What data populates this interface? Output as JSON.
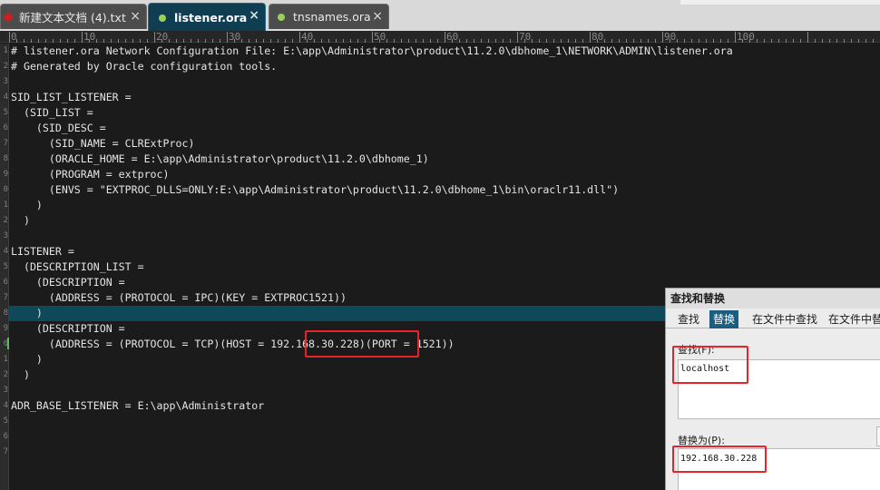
{
  "tabs": [
    {
      "label": "新建文本文档 (4).txt",
      "close": "×"
    },
    {
      "label": "listener.ora",
      "close": "×"
    },
    {
      "label": "tnsnames.ora",
      "close": "×"
    }
  ],
  "ruler": {
    "labels": [
      "0",
      "10",
      "20",
      "30",
      "40",
      "50",
      "60",
      "70",
      "80",
      "90",
      "100"
    ]
  },
  "gutter": {
    "numbers": [
      "1",
      "2",
      "3",
      "4",
      "5",
      "6",
      "7",
      "8",
      "9",
      "0",
      "1",
      "2",
      "3",
      "4",
      "5",
      "6",
      "7",
      "8",
      "9",
      "0",
      "1",
      "2",
      "3",
      "4",
      "5",
      "6",
      "7"
    ]
  },
  "code": {
    "lines": [
      "# listener.ora Network Configuration File: E:\\app\\Administrator\\product\\11.2.0\\dbhome_1\\NETWORK\\ADMIN\\listener.ora",
      "# Generated by Oracle configuration tools.",
      "",
      "SID_LIST_LISTENER =",
      "  (SID_LIST =",
      "    (SID_DESC =",
      "      (SID_NAME = CLRExtProc)",
      "      (ORACLE_HOME = E:\\app\\Administrator\\product\\11.2.0\\dbhome_1)",
      "      (PROGRAM = extproc)",
      "      (ENVS = \"EXTPROC_DLLS=ONLY:E:\\app\\Administrator\\product\\11.2.0\\dbhome_1\\bin\\oraclr11.dll\")",
      "    )",
      "  )",
      "",
      "LISTENER =",
      "  (DESCRIPTION_LIST =",
      "    (DESCRIPTION =",
      "      (ADDRESS = (PROTOCOL = IPC)(KEY = EXTPROC1521))",
      "    )",
      "    (DESCRIPTION =",
      "      (ADDRESS = (PROTOCOL = TCP)(HOST = 192.168.30.228)(PORT = 1521))",
      "    )",
      "  )",
      "",
      "ADR_BASE_LISTENER = E:\\app\\Administrator",
      "",
      "",
      ""
    ]
  },
  "find_replace": {
    "title": "查找和替换",
    "tabs": [
      "查找",
      "替换",
      "在文件中查找",
      "在文件中替"
    ],
    "find_label": "查找(F):",
    "find_value": "localhost",
    "replace_label": "替换为(P):",
    "replace_value": "192.168.30.228"
  },
  "colors": {
    "editor_bg": "#1b1b1b",
    "active_tab": "#0f3d52",
    "highlight_line": "#0f4859",
    "annotation_red": "#e8232a"
  }
}
